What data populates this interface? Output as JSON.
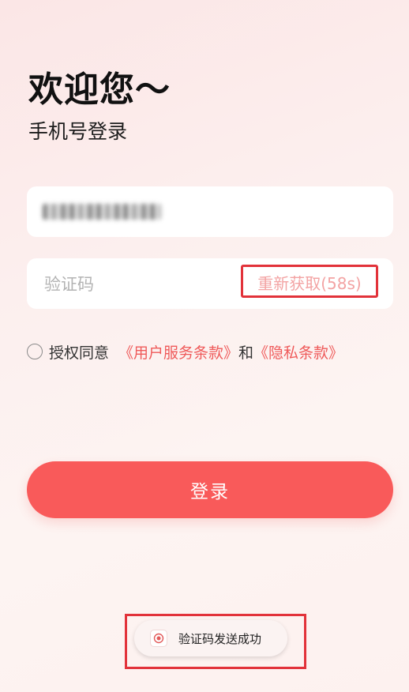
{
  "header": {
    "title": "欢迎您～",
    "subtitle": "手机号登录"
  },
  "form": {
    "phone": {
      "value": "1 *** ****"
    },
    "code": {
      "placeholder": "验证码",
      "resend_label": "重新获取(58s)"
    },
    "agreement": {
      "prefix": "授权同意",
      "terms_link": "《用户服务条款》",
      "conjunction": "和",
      "privacy_link": "《隐私条款》",
      "checked": false
    },
    "login_label": "登录"
  },
  "toast": {
    "icon": "app-logo-icon",
    "message": "验证码发送成功"
  },
  "colors": {
    "accent": "#f95a5a",
    "link": "#ef5a5a",
    "highlight_box": "#e2323a",
    "resend_text": "#f3a3a3"
  }
}
